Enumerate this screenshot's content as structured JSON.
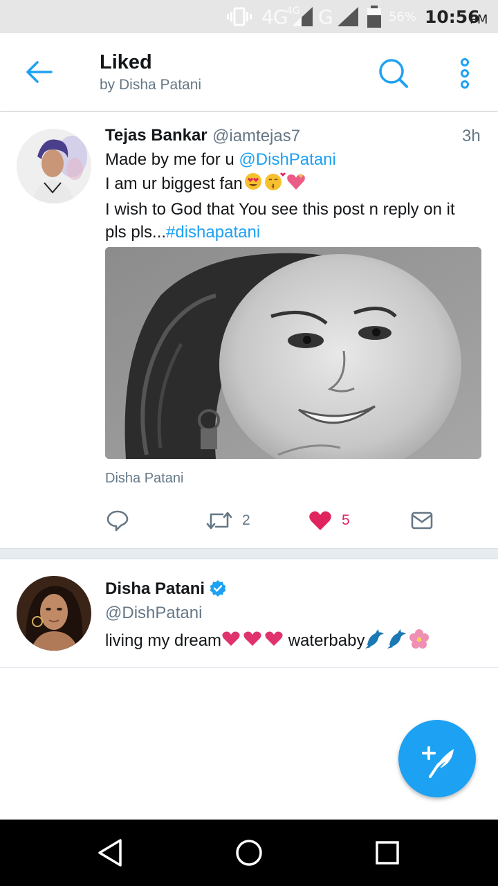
{
  "status_bar": {
    "network_large": "4G",
    "network_small": "4G",
    "network_g": "G",
    "battery_percent": "56%",
    "time": "10:56",
    "ampm": "PM"
  },
  "header": {
    "title": "Liked",
    "subtitle": "by Disha Patani"
  },
  "tweets": [
    {
      "name": "Tejas Bankar",
      "handle": "@iamtejas7",
      "time": "3h",
      "text_1_prefix": "Made by me for u ",
      "text_1_mention": "@DishPatani",
      "text_2": "I am ur biggest fan",
      "text_3": "I wish to God that You see this post n reply on it",
      "text_4_prefix": "pls pls...",
      "text_4_hashtag": "#dishapatani",
      "media_tag": "Disha Patani",
      "retweet_count": "2",
      "like_count": "5",
      "liked": true
    },
    {
      "name": "Disha Patani",
      "verified": true,
      "handle": "@DishPatani",
      "text_prefix": "living my dream",
      "text_middle": "waterbaby"
    }
  ],
  "colors": {
    "accent": "#1da1f2",
    "like": "#e0245e",
    "muted": "#657786"
  },
  "icons": {
    "back": "arrow-left-icon",
    "search": "search-icon",
    "more": "more-vertical-icon",
    "reply": "reply-icon",
    "retweet": "retweet-icon",
    "like": "heart-icon",
    "dm": "envelope-icon",
    "compose": "compose-feather-icon"
  }
}
